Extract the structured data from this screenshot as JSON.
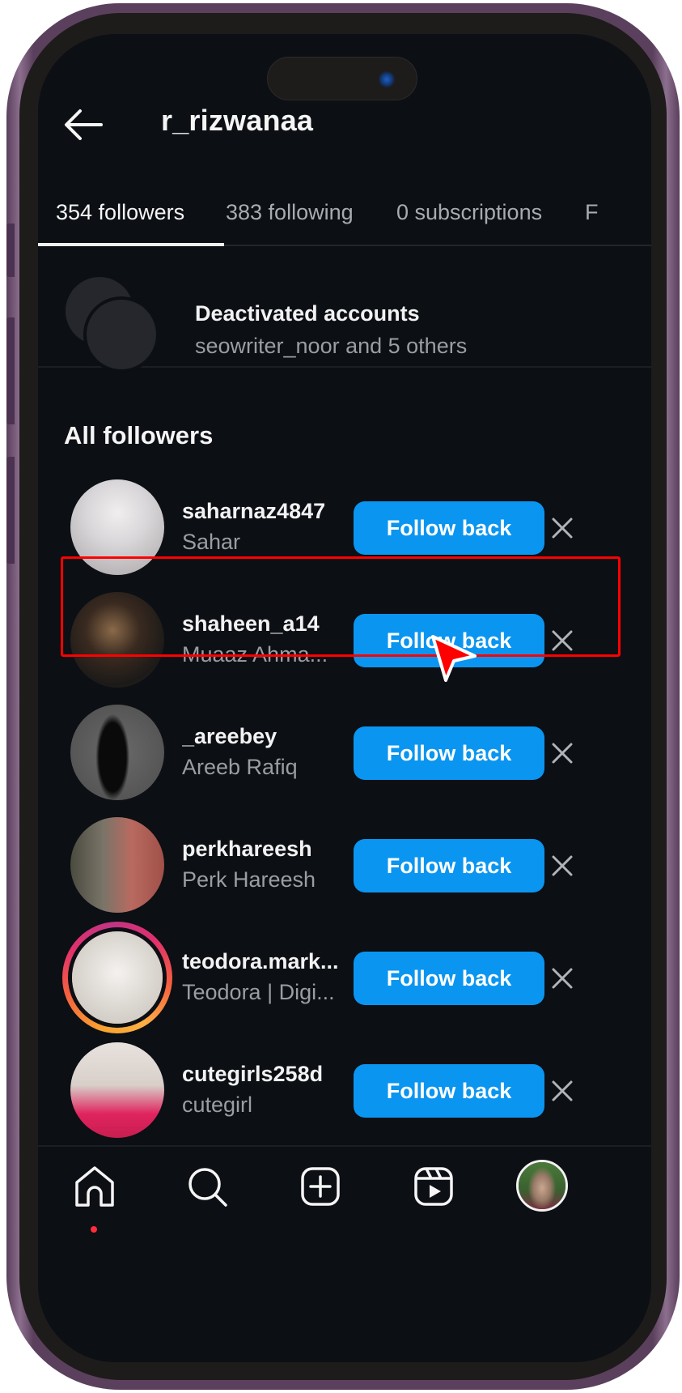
{
  "header": {
    "title": "r_rizwanaa",
    "back_icon": "arrow-left-icon"
  },
  "tabs": [
    {
      "label": "354 followers",
      "active": true
    },
    {
      "label": "383 following",
      "active": false
    },
    {
      "label": "0 subscriptions",
      "active": false
    },
    {
      "label": "F",
      "active": false
    }
  ],
  "deactivated": {
    "title": "Deactivated accounts",
    "subtitle": "seowriter_noor and 5 others"
  },
  "section_title": "All followers",
  "followers": [
    {
      "username": "saharnaz4847",
      "name": "Sahar",
      "button": "Follow back",
      "story": false
    },
    {
      "username": "shaheen_a14",
      "name": "Muaaz Ahma...",
      "button": "Follow back",
      "story": false,
      "highlighted": true
    },
    {
      "username": "_areebey",
      "name": "Areeb Rafiq",
      "button": "Follow back",
      "story": false
    },
    {
      "username": "perkhareesh",
      "name": "Perk Hareesh",
      "button": "Follow back",
      "story": false
    },
    {
      "username": "teodora.mark...",
      "name": "Teodora | Digi...",
      "button": "Follow back",
      "story": true
    },
    {
      "username": "cutegirls258d",
      "name": "cutegirl",
      "button": "Follow back",
      "story": false
    }
  ],
  "bottom_nav": {
    "items": [
      "home-icon",
      "search-icon",
      "create-icon",
      "reels-icon",
      "profile-avatar"
    ],
    "home_notification_dot": true
  },
  "colors": {
    "accent": "#0a95f0",
    "background": "#0c0f14",
    "highlight": "#ff0000",
    "frame": "#5b405d"
  }
}
